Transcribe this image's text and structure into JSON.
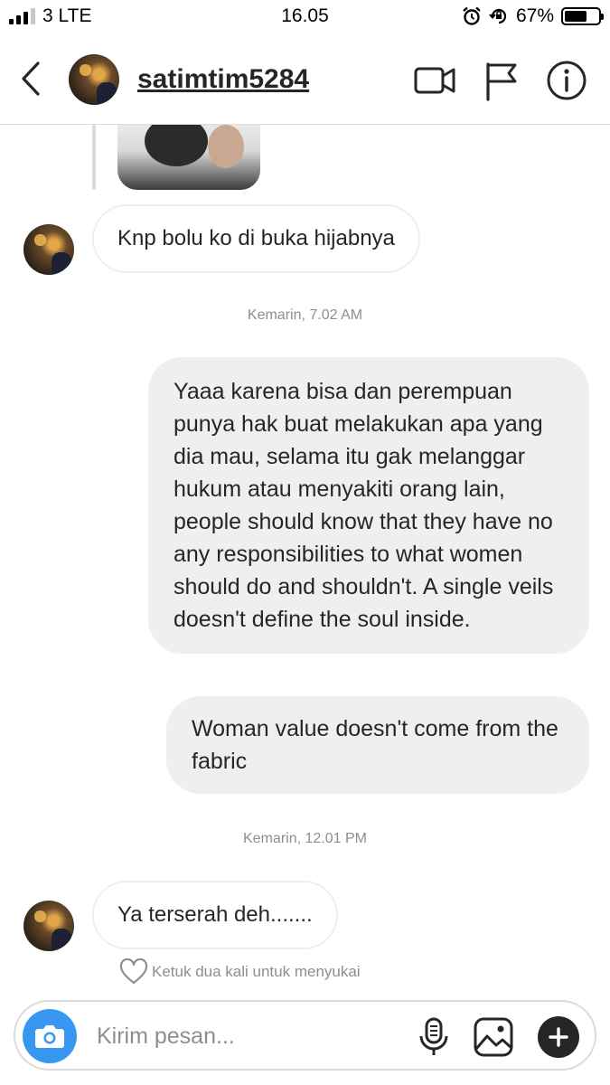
{
  "status_bar": {
    "carrier": "3 LTE",
    "time": "16.05",
    "battery": "67%",
    "battery_level": 0.67
  },
  "header": {
    "username": "satimtim5284"
  },
  "messages": [
    {
      "sender": "other",
      "text": "Knp bolu ko di buka hijabnya"
    },
    {
      "timestamp": "Kemarin, 7.02 AM"
    },
    {
      "sender": "me",
      "text": "Yaaa karena bisa dan perempuan punya hak buat melakukan apa yang dia mau, selama itu gak melanggar hukum atau menyakiti orang lain, people should know that they have no any responsibilities to what women should do and shouldn't. A single veils doesn't define the soul inside."
    },
    {
      "sender": "me",
      "text": "Woman value doesn't come from the fabric"
    },
    {
      "timestamp": "Kemarin, 12.01 PM"
    },
    {
      "sender": "other",
      "text": "Ya terserah deh......."
    }
  ],
  "like_hint": "Ketuk dua kali untuk menyukai",
  "composer": {
    "placeholder": "Kirim pesan..."
  },
  "colors": {
    "accent": "#3897f0",
    "bubble_out": "#efefef",
    "muted": "#8e8e8e"
  }
}
